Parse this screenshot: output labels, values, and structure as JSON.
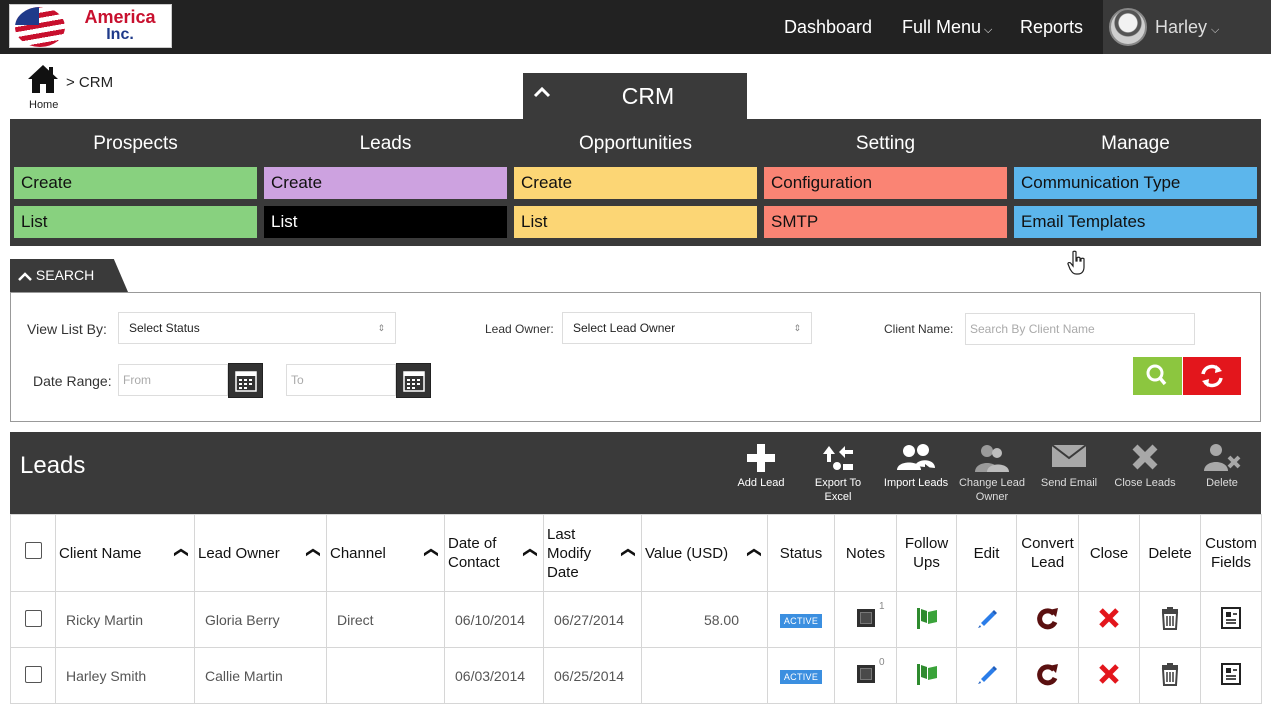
{
  "logo": {
    "line1": "America",
    "line2": "Inc."
  },
  "nav": {
    "dashboard": "Dashboard",
    "full_menu": "Full Menu",
    "reports": "Reports",
    "user": "Harley"
  },
  "breadcrumb": {
    "home": "Home",
    "current": "> CRM"
  },
  "crm_tab": {
    "label": "CRM"
  },
  "crm_menu": {
    "prospects": {
      "title": "Prospects",
      "create": "Create",
      "list": "List"
    },
    "leads": {
      "title": "Leads",
      "create": "Create",
      "list": "List"
    },
    "opportunities": {
      "title": "Opportunities",
      "create": "Create",
      "list": "List"
    },
    "setting": {
      "title": "Setting",
      "configuration": "Configuration",
      "smtp": "SMTP"
    },
    "manage": {
      "title": "Manage",
      "communication_type": "Communication Type",
      "email_templates": "Email Templates"
    }
  },
  "search": {
    "tab_label": "SEARCH",
    "view_list_label": "View List By:",
    "status_value": "Select Status",
    "lead_owner_label": "Lead Owner:",
    "lead_owner_value": "Select Lead Owner",
    "client_name_label": "Client Name:",
    "client_name_placeholder": "Search By Client Name",
    "date_range_label": "Date Range:",
    "from_placeholder": "From",
    "to_placeholder": "To"
  },
  "leads": {
    "title": "Leads",
    "actions": {
      "add": "Add Lead",
      "export_1": "Export To",
      "export_2": "Excel",
      "import": "Import Leads",
      "change_1": "Change Lead",
      "change_2": "Owner",
      "send_email": "Send Email",
      "close": "Close Leads",
      "delete": "Delete"
    },
    "columns": {
      "client_name": "Client Name",
      "lead_owner": "Lead Owner",
      "channel": "Channel",
      "date_contact_1": "Date of",
      "date_contact_2": "Contact",
      "last_modify_1": "Last",
      "last_modify_2": "Modify",
      "last_modify_3": "Date",
      "value": "Value (USD)",
      "status": "Status",
      "notes": "Notes",
      "follow_1": "Follow",
      "follow_2": "Ups",
      "edit": "Edit",
      "convert_1": "Convert",
      "convert_2": "Lead",
      "close": "Close",
      "delete": "Delete",
      "custom_1": "Custom",
      "custom_2": "Fields"
    },
    "rows": [
      {
        "client": "Ricky Martin",
        "owner": "Gloria Berry",
        "channel": "Direct",
        "contact": "06/10/2014",
        "modified": "06/27/2014",
        "value": "58.00",
        "status": "ACTIVE",
        "notes": "1"
      },
      {
        "client": "Harley Smith",
        "owner": "Callie Martin",
        "channel": "",
        "contact": "06/03/2014",
        "modified": "06/25/2014",
        "value": "",
        "status": "ACTIVE",
        "notes": "0"
      }
    ]
  },
  "colors": {
    "green": "#88d17f",
    "purple": "#cda2e0",
    "yellow": "#fcd675",
    "salmon": "#fa8474",
    "blue": "#5cb6ec",
    "selected": "#000000"
  }
}
